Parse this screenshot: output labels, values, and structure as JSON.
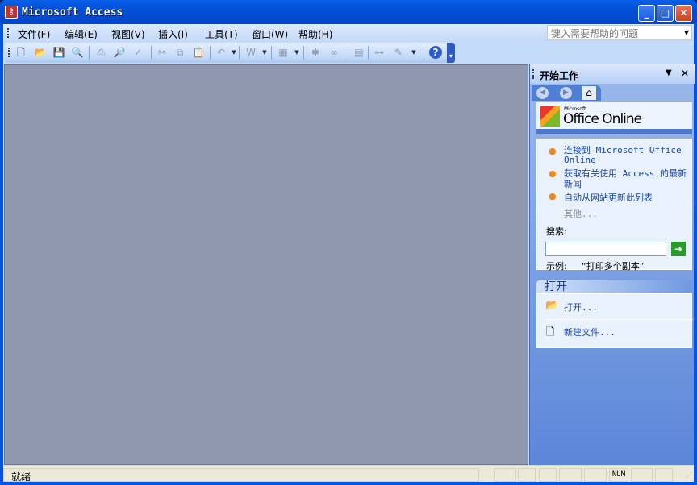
{
  "window": {
    "title": "Microsoft Access",
    "minimize": "_",
    "maximize": "□",
    "close": "✕"
  },
  "menu": [
    "文件(F)",
    "编辑(E)",
    "视图(V)",
    "插入(I)",
    "工具(T)",
    "窗口(W)",
    "帮助(H)"
  ],
  "help_box": {
    "placeholder": "键入需要帮助的问题"
  },
  "toolbar": [
    {
      "name": "new-icon",
      "glyph": "🗋",
      "enabled": true
    },
    {
      "name": "open-icon",
      "glyph": "📂",
      "enabled": true
    },
    {
      "name": "save-icon",
      "glyph": "💾",
      "enabled": false
    },
    {
      "name": "file-search-icon",
      "glyph": "🔍",
      "enabled": true
    },
    {
      "name": "print-icon",
      "glyph": "⎙",
      "enabled": false
    },
    {
      "name": "print-preview-icon",
      "glyph": "🔎",
      "enabled": false
    },
    {
      "name": "spelling-icon",
      "glyph": "✓",
      "enabled": false
    },
    {
      "name": "cut-icon",
      "glyph": "✂",
      "enabled": false
    },
    {
      "name": "copy-icon",
      "glyph": "⧉",
      "enabled": false
    },
    {
      "name": "paste-icon",
      "glyph": "📋",
      "enabled": false
    },
    {
      "name": "undo-icon",
      "glyph": "↶",
      "enabled": false
    },
    {
      "name": "office-links-icon",
      "glyph": "W",
      "enabled": false
    },
    {
      "name": "analyze-icon",
      "glyph": "▦",
      "enabled": false
    },
    {
      "name": "code-icon",
      "glyph": "✱",
      "enabled": false
    },
    {
      "name": "script-icon",
      "glyph": "∞",
      "enabled": false
    },
    {
      "name": "properties-icon",
      "glyph": "▤",
      "enabled": false
    },
    {
      "name": "relationships-icon",
      "glyph": "⊶",
      "enabled": false
    },
    {
      "name": "new-object-icon",
      "glyph": "✎",
      "enabled": false
    },
    {
      "name": "help-icon",
      "glyph": "?",
      "enabled": true
    }
  ],
  "task_pane": {
    "title": "开始工作",
    "logo": "Microsoft Office Online",
    "links": [
      "连接到 Microsoft Office Online",
      "获取有关使用 Access 的最新新闻",
      "自动从网站更新此列表"
    ],
    "more": "其他...",
    "search_label": "搜索:",
    "search_value": "",
    "example_label": "示例:",
    "example_text": "“打印多个副本”",
    "open_section": "打开",
    "open_link": "打开...",
    "new_link": "新建文件..."
  },
  "status": {
    "text": "就绪",
    "num": "NUM"
  }
}
